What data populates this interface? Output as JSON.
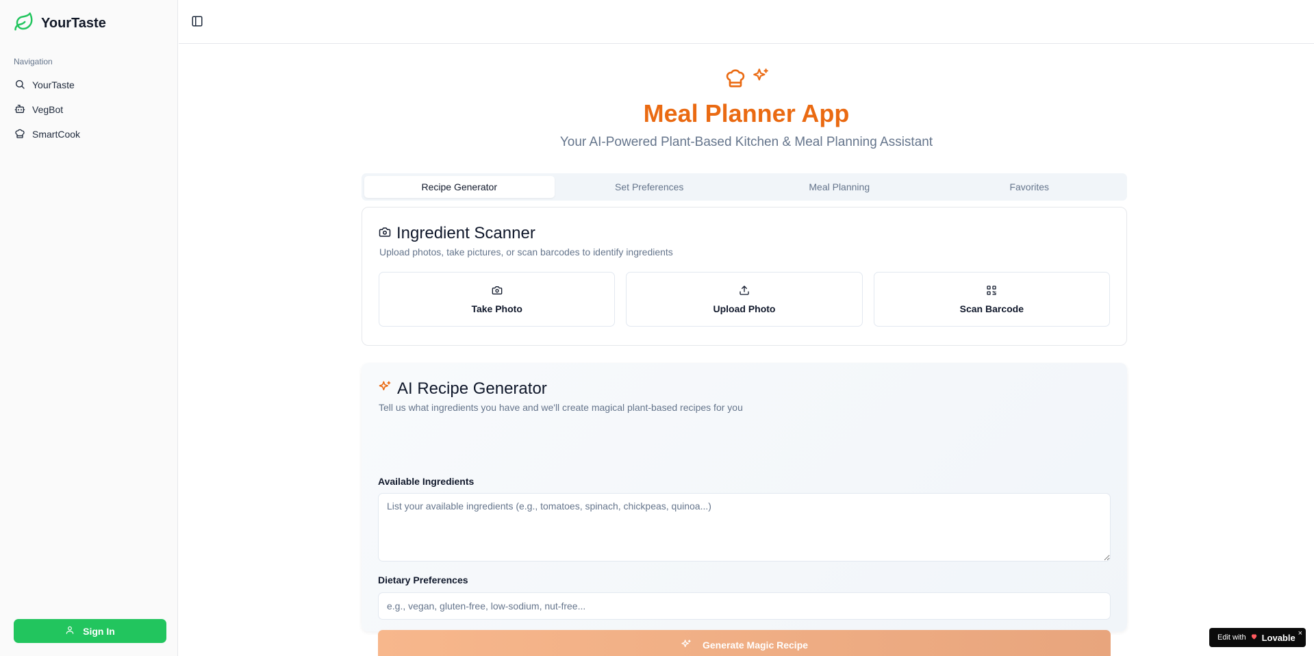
{
  "app": {
    "brand_name": "YourTaste",
    "brand_icon": "leaf-icon",
    "accent_green": "#22c55e",
    "accent_orange": "#ea6a12"
  },
  "sidebar": {
    "nav_heading": "Navigation",
    "items": [
      {
        "label": "YourTaste",
        "icon": "search-icon"
      },
      {
        "label": "VegBot",
        "icon": "bot-icon"
      },
      {
        "label": "SmartCook",
        "icon": "chef-hat-icon"
      }
    ],
    "signin_label": "Sign In"
  },
  "header": {
    "title": "Meal Planner App",
    "subtitle": "Your AI-Powered Plant-Based Kitchen & Meal Planning Assistant"
  },
  "tabs": [
    {
      "label": "Recipe Generator",
      "active": true
    },
    {
      "label": "Set Preferences",
      "active": false
    },
    {
      "label": "Meal Planning",
      "active": false
    },
    {
      "label": "Favorites",
      "active": false
    }
  ],
  "scanner": {
    "title": "Ingredient Scanner",
    "description": "Upload photos, take pictures, or scan barcodes to identify ingredients",
    "buttons": [
      {
        "label": "Take Photo",
        "icon": "camera-icon"
      },
      {
        "label": "Upload Photo",
        "icon": "upload-icon"
      },
      {
        "label": "Scan Barcode",
        "icon": "qr-code-icon"
      }
    ]
  },
  "generator": {
    "title": "AI Recipe Generator",
    "description": "Tell us what ingredients you have and we'll create magical plant-based recipes for you",
    "ingredients_label": "Available Ingredients",
    "ingredients_placeholder": "List your available ingredients (e.g., tomatoes, spinach, chickpeas, quinoa...)",
    "dietary_label": "Dietary Preferences",
    "dietary_placeholder": "e.g., vegan, gluten-free, low-sodium, nut-free...",
    "button_label": "Generate Magic Recipe"
  },
  "badge": {
    "prefix": "Edit with",
    "brand": "Lovable",
    "close": "×"
  }
}
